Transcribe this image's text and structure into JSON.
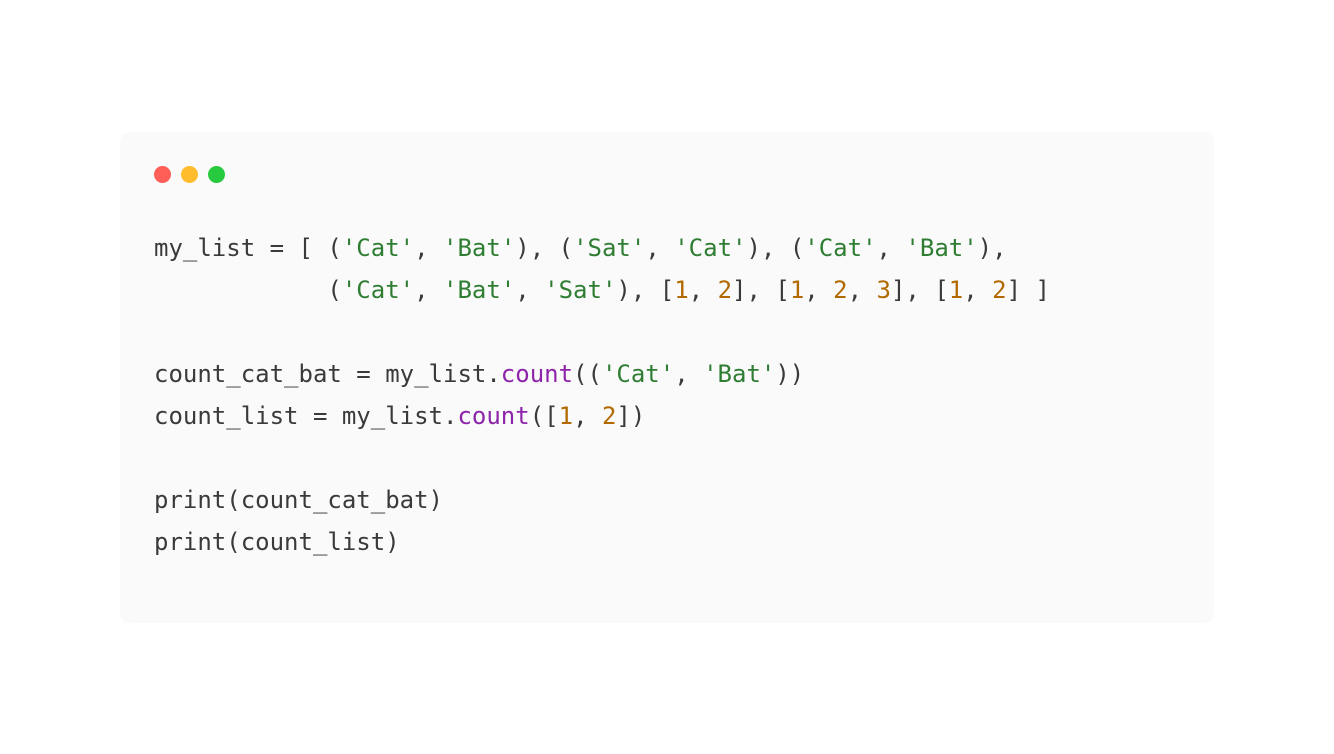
{
  "code": {
    "tokens": [
      [
        {
          "t": "my_list",
          "c": "ident"
        },
        {
          "t": " ",
          "c": "ws"
        },
        {
          "t": "=",
          "c": "op"
        },
        {
          "t": " [ (",
          "c": "punct"
        },
        {
          "t": "'Cat'",
          "c": "str"
        },
        {
          "t": ", ",
          "c": "punct"
        },
        {
          "t": "'Bat'",
          "c": "str"
        },
        {
          "t": "), (",
          "c": "punct"
        },
        {
          "t": "'Sat'",
          "c": "str"
        },
        {
          "t": ", ",
          "c": "punct"
        },
        {
          "t": "'Cat'",
          "c": "str"
        },
        {
          "t": "), (",
          "c": "punct"
        },
        {
          "t": "'Cat'",
          "c": "str"
        },
        {
          "t": ", ",
          "c": "punct"
        },
        {
          "t": "'Bat'",
          "c": "str"
        },
        {
          "t": "),",
          "c": "punct"
        }
      ],
      [
        {
          "t": "            (",
          "c": "punct"
        },
        {
          "t": "'Cat'",
          "c": "str"
        },
        {
          "t": ", ",
          "c": "punct"
        },
        {
          "t": "'Bat'",
          "c": "str"
        },
        {
          "t": ", ",
          "c": "punct"
        },
        {
          "t": "'Sat'",
          "c": "str"
        },
        {
          "t": "), [",
          "c": "punct"
        },
        {
          "t": "1",
          "c": "num"
        },
        {
          "t": ", ",
          "c": "punct"
        },
        {
          "t": "2",
          "c": "num"
        },
        {
          "t": "], [",
          "c": "punct"
        },
        {
          "t": "1",
          "c": "num"
        },
        {
          "t": ", ",
          "c": "punct"
        },
        {
          "t": "2",
          "c": "num"
        },
        {
          "t": ", ",
          "c": "punct"
        },
        {
          "t": "3",
          "c": "num"
        },
        {
          "t": "], [",
          "c": "punct"
        },
        {
          "t": "1",
          "c": "num"
        },
        {
          "t": ", ",
          "c": "punct"
        },
        {
          "t": "2",
          "c": "num"
        },
        {
          "t": "] ]",
          "c": "punct"
        }
      ],
      [],
      [
        {
          "t": "count_cat_bat",
          "c": "ident"
        },
        {
          "t": " ",
          "c": "ws"
        },
        {
          "t": "=",
          "c": "op"
        },
        {
          "t": " my_list.",
          "c": "ident"
        },
        {
          "t": "count",
          "c": "method"
        },
        {
          "t": "((",
          "c": "punct"
        },
        {
          "t": "'Cat'",
          "c": "str"
        },
        {
          "t": ", ",
          "c": "punct"
        },
        {
          "t": "'Bat'",
          "c": "str"
        },
        {
          "t": "))",
          "c": "punct"
        }
      ],
      [
        {
          "t": "count_list",
          "c": "ident"
        },
        {
          "t": " ",
          "c": "ws"
        },
        {
          "t": "=",
          "c": "op"
        },
        {
          "t": " my_list.",
          "c": "ident"
        },
        {
          "t": "count",
          "c": "method"
        },
        {
          "t": "([",
          "c": "punct"
        },
        {
          "t": "1",
          "c": "num"
        },
        {
          "t": ", ",
          "c": "punct"
        },
        {
          "t": "2",
          "c": "num"
        },
        {
          "t": "])",
          "c": "punct"
        }
      ],
      [],
      [
        {
          "t": "print",
          "c": "kw"
        },
        {
          "t": "(count_cat_bat)",
          "c": "punct"
        }
      ],
      [
        {
          "t": "print",
          "c": "kw"
        },
        {
          "t": "(count_list)",
          "c": "punct"
        }
      ]
    ]
  }
}
